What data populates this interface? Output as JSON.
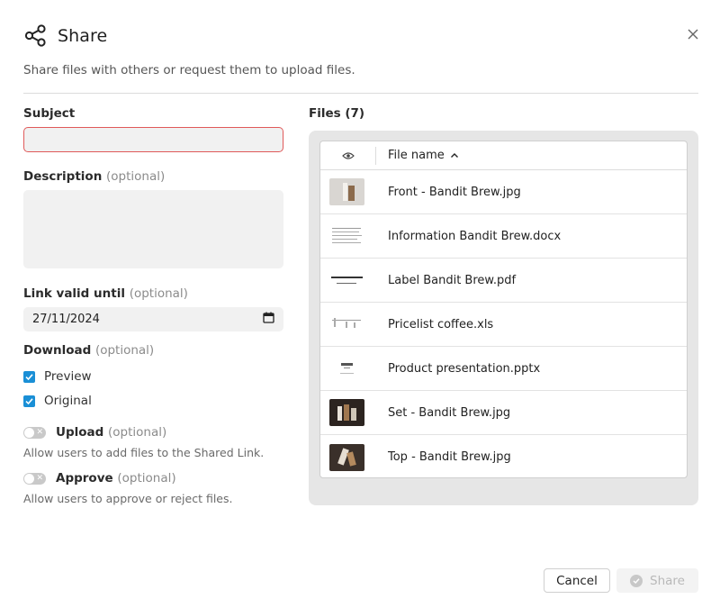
{
  "dialog": {
    "title": "Share",
    "subtitle": "Share files with others or request them to upload files."
  },
  "form": {
    "subject_label": "Subject",
    "subject_value": "",
    "description_label": "Description",
    "description_optional": "(optional)",
    "description_value": "",
    "link_valid_label": "Link valid until",
    "link_valid_optional": "(optional)",
    "link_valid_value": "27/11/2024",
    "download_label": "Download",
    "download_optional": "(optional)",
    "download_options": [
      {
        "label": "Preview",
        "checked": true
      },
      {
        "label": "Original",
        "checked": true
      }
    ],
    "upload": {
      "label": "Upload",
      "optional": "(optional)",
      "enabled": false,
      "help": "Allow users to add files to the Shared Link."
    },
    "approve": {
      "label": "Approve",
      "optional": "(optional)",
      "enabled": false,
      "help": "Allow users to approve or reject files."
    }
  },
  "files": {
    "title": "Files (7)",
    "column_header": "File name",
    "items": [
      {
        "name": "Front - Bandit Brew.jpg",
        "thumb": "image-light"
      },
      {
        "name": "Information Bandit Brew.docx",
        "thumb": "document"
      },
      {
        "name": "Label Bandit Brew.pdf",
        "thumb": "pdf"
      },
      {
        "name": "Pricelist coffee.xls",
        "thumb": "spreadsheet"
      },
      {
        "name": "Product presentation.pptx",
        "thumb": "presentation"
      },
      {
        "name": "Set - Bandit Brew.jpg",
        "thumb": "image-dark"
      },
      {
        "name": "Top - Bandit Brew.jpg",
        "thumb": "image-dark"
      }
    ]
  },
  "footer": {
    "cancel_label": "Cancel",
    "share_label": "Share"
  },
  "colors": {
    "accent": "#1a8fd6",
    "error_border": "#e05a5a",
    "input_bg": "#f1f1f1"
  }
}
